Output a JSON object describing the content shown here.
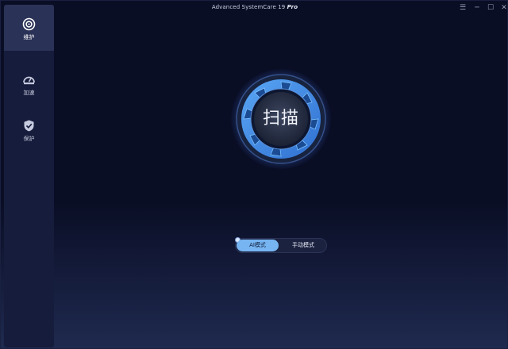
{
  "window": {
    "title": "Advanced SystemCare 19",
    "edition": "Pro"
  },
  "title_buttons": {
    "menu": "☰",
    "minimize": "─",
    "maximize": "☐",
    "close": "✕"
  },
  "sidebar": {
    "items": [
      {
        "label": "维护",
        "icon": "maintenance-icon",
        "active": true
      },
      {
        "label": "加速",
        "icon": "speedometer-icon",
        "active": false
      },
      {
        "label": "保护",
        "icon": "shield-check-icon",
        "active": false
      }
    ]
  },
  "scan": {
    "label": "扫描"
  },
  "mode": {
    "ai_label": "AI模式",
    "manual_label": "手动模式",
    "selected": "AI模式"
  },
  "colors": {
    "accent": "#77b5f2",
    "ring": "#4a90e2",
    "background": "#0a0e25",
    "sidebar": "#161c3b"
  }
}
